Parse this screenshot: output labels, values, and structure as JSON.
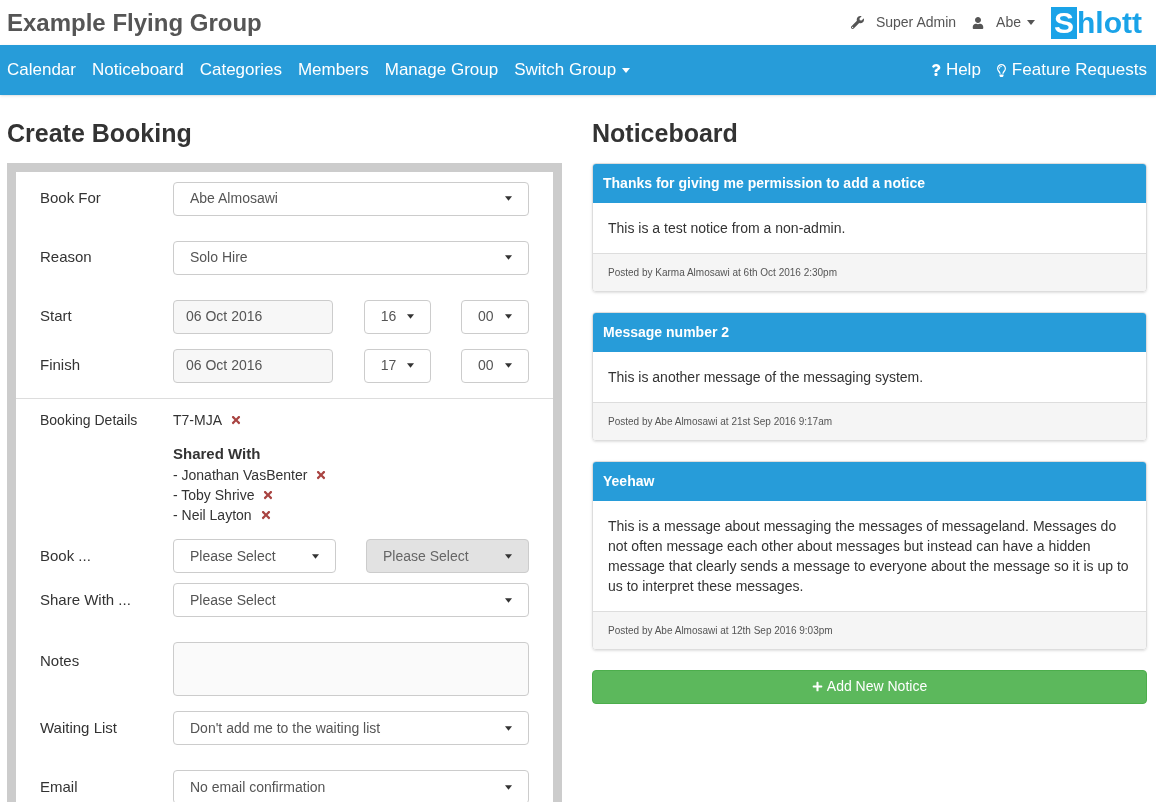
{
  "header": {
    "title": "Example Flying Group",
    "user_menu": [
      {
        "kind": "admin",
        "label": "Super Admin",
        "dropdown": false
      },
      {
        "kind": "user",
        "label": "Abe",
        "dropdown": true
      }
    ],
    "logo": {
      "boxed": "S",
      "rest": "hlott"
    }
  },
  "nav": {
    "left": [
      {
        "label": "Calendar",
        "dropdown": false
      },
      {
        "label": "Noticeboard",
        "dropdown": false
      },
      {
        "label": "Categories",
        "dropdown": false
      },
      {
        "label": "Members",
        "dropdown": false
      },
      {
        "label": "Manage Group",
        "dropdown": false
      },
      {
        "label": "Switch Group",
        "dropdown": true
      }
    ],
    "right": [
      {
        "kind": "help",
        "label": "Help"
      },
      {
        "kind": "idea",
        "label": "Feature Requests"
      }
    ]
  },
  "booking": {
    "title": "Create Booking",
    "fields": [
      {
        "kind": "select",
        "label": "Book For",
        "value": "Abe Almosawi"
      },
      {
        "kind": "select",
        "label": "Reason",
        "value": "Solo Hire"
      },
      {
        "kind": "datetime",
        "label": "Start",
        "date": "06 Oct 2016",
        "hour": "16",
        "minute": "00"
      },
      {
        "kind": "datetime",
        "label": "Finish",
        "date": "06 Oct 2016",
        "hour": "17",
        "minute": "00"
      },
      {
        "kind": "details",
        "label": "Booking Details",
        "item": "T7-MJA",
        "shared_title": "Shared With",
        "shared": [
          "- Jonathan VasBenter",
          "- Toby Shrive",
          "- Neil Layton"
        ]
      },
      {
        "kind": "split_select",
        "label": "Book ...",
        "selects": [
          {
            "value": "Please Select",
            "disabled": false
          },
          {
            "value": "Please Select",
            "disabled": true
          }
        ]
      },
      {
        "kind": "select",
        "label": "Share With ...",
        "value": "Please Select"
      },
      {
        "kind": "textarea",
        "label": "Notes"
      },
      {
        "kind": "select",
        "label": "Waiting List",
        "value": "Don't add me to the waiting list"
      },
      {
        "kind": "select",
        "label": "Email",
        "value": "No email confirmation"
      }
    ]
  },
  "noticeboard": {
    "title": "Noticeboard",
    "notices": [
      {
        "title": "Thanks for giving me permission to add a notice",
        "body": "This is a test notice from a non-admin.",
        "footer": "Posted by Karma Almosawi at 6th Oct 2016 2:30pm"
      },
      {
        "title": "Message number 2",
        "body": "This is another message of the messaging system.",
        "footer": "Posted by Abe Almosawi at 21st Sep 2016 9:17am"
      },
      {
        "title": "Yeehaw",
        "body": "This is a message about messaging the messages of messageland. Messages do not often message each other about messages but instead can have a hidden message that clearly sends a message to everyone about the message so it is up to us to interpret these messages.",
        "footer": "Posted by Abe Almosawi at 12th Sep 2016 9:03pm"
      }
    ],
    "add_button": "Add New Notice"
  }
}
